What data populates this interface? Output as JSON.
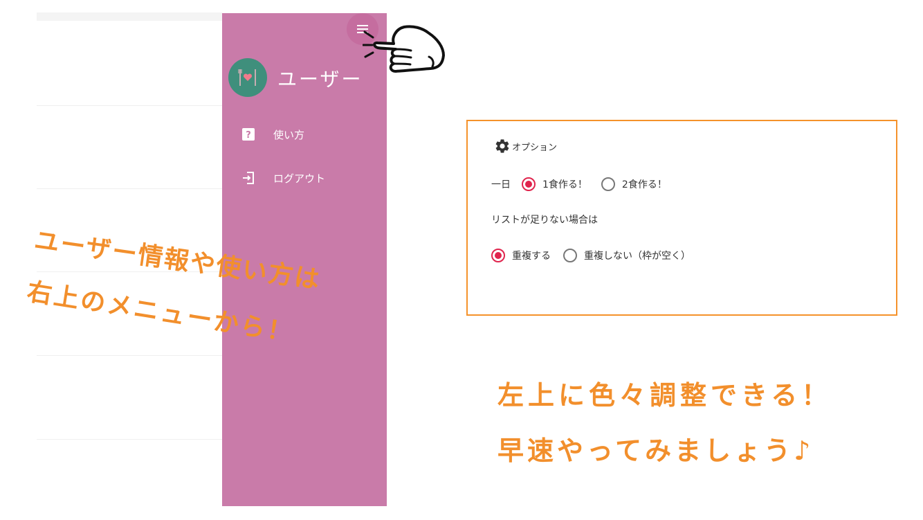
{
  "drawer": {
    "user_name": "ユーザー",
    "items": [
      {
        "label": "使い方",
        "icon": "help-icon"
      },
      {
        "label": "ログアウト",
        "icon": "logout-icon"
      }
    ],
    "color": "#c97ba9",
    "avatar_color": "#3f8f7c"
  },
  "captions": {
    "menu_hint_line1": "ユーザー情報や使い方は",
    "menu_hint_line2": "右上のメニューから！",
    "options_hint_line1": "左上に色々調整できる！",
    "options_hint_line2": "早速やってみましょう♪",
    "color": "#f28f2c"
  },
  "options": {
    "title": "オプション",
    "per_day_label": "一日",
    "per_day_choices": [
      {
        "label": "1食作る！",
        "selected": true
      },
      {
        "label": "2食作る！",
        "selected": false
      }
    ],
    "shortage_question": "リストが足りない場合は",
    "shortage_choices": [
      {
        "label": "重複する",
        "selected": true
      },
      {
        "label": "重複しない（枠が空く）",
        "selected": false
      }
    ],
    "accent_color": "#e0244d",
    "border_color": "#f5922a"
  }
}
